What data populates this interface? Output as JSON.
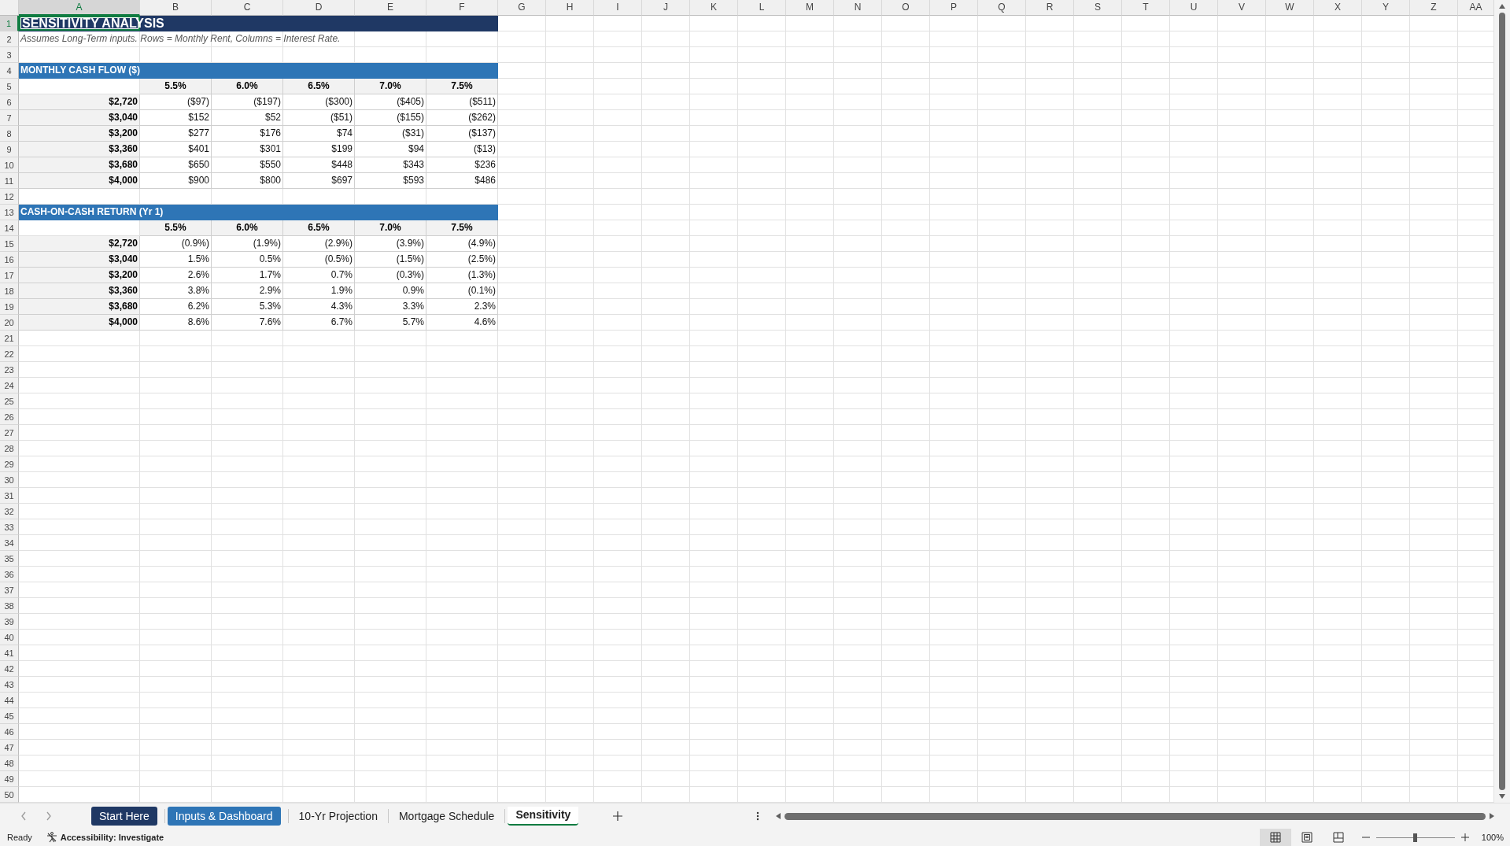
{
  "column_headers": [
    {
      "label": "A",
      "selected": true
    },
    {
      "label": "B",
      "selected": false
    },
    {
      "label": "C",
      "selected": false
    },
    {
      "label": "D",
      "selected": false
    },
    {
      "label": "E",
      "selected": false
    },
    {
      "label": "F",
      "selected": false
    },
    {
      "label": "G",
      "selected": false
    },
    {
      "label": "H",
      "selected": false
    },
    {
      "label": "I",
      "selected": false
    },
    {
      "label": "J",
      "selected": false
    },
    {
      "label": "K",
      "selected": false
    },
    {
      "label": "L",
      "selected": false
    },
    {
      "label": "M",
      "selected": false
    },
    {
      "label": "N",
      "selected": false
    },
    {
      "label": "O",
      "selected": false
    },
    {
      "label": "P",
      "selected": false
    },
    {
      "label": "Q",
      "selected": false
    },
    {
      "label": "R",
      "selected": false
    },
    {
      "label": "S",
      "selected": false
    },
    {
      "label": "T",
      "selected": false
    },
    {
      "label": "U",
      "selected": false
    },
    {
      "label": "V",
      "selected": false
    },
    {
      "label": "W",
      "selected": false
    },
    {
      "label": "X",
      "selected": false
    },
    {
      "label": "Y",
      "selected": false
    },
    {
      "label": "Z",
      "selected": false
    },
    {
      "label": "AA",
      "selected": false
    }
  ],
  "row_headers": [
    {
      "label": "1",
      "selected": true
    },
    {
      "label": "2",
      "selected": false
    },
    {
      "label": "3",
      "selected": false
    },
    {
      "label": "4",
      "selected": false
    },
    {
      "label": "5",
      "selected": false
    },
    {
      "label": "6",
      "selected": false
    },
    {
      "label": "7",
      "selected": false
    },
    {
      "label": "8",
      "selected": false
    },
    {
      "label": "9",
      "selected": false
    },
    {
      "label": "10",
      "selected": false
    },
    {
      "label": "11",
      "selected": false
    },
    {
      "label": "12",
      "selected": false
    },
    {
      "label": "13",
      "selected": false
    },
    {
      "label": "14",
      "selected": false
    },
    {
      "label": "15",
      "selected": false
    },
    {
      "label": "16",
      "selected": false
    },
    {
      "label": "17",
      "selected": false
    },
    {
      "label": "18",
      "selected": false
    },
    {
      "label": "19",
      "selected": false
    },
    {
      "label": "20",
      "selected": false
    },
    {
      "label": "21",
      "selected": false
    },
    {
      "label": "22",
      "selected": false
    },
    {
      "label": "23",
      "selected": false
    },
    {
      "label": "24",
      "selected": false
    },
    {
      "label": "25",
      "selected": false
    },
    {
      "label": "26",
      "selected": false
    },
    {
      "label": "27",
      "selected": false
    },
    {
      "label": "28",
      "selected": false
    },
    {
      "label": "29",
      "selected": false
    },
    {
      "label": "30",
      "selected": false
    },
    {
      "label": "31",
      "selected": false
    },
    {
      "label": "32",
      "selected": false
    },
    {
      "label": "33",
      "selected": false
    },
    {
      "label": "34",
      "selected": false
    },
    {
      "label": "35",
      "selected": false
    },
    {
      "label": "36",
      "selected": false
    },
    {
      "label": "37",
      "selected": false
    },
    {
      "label": "38",
      "selected": false
    },
    {
      "label": "39",
      "selected": false
    },
    {
      "label": "40",
      "selected": false
    },
    {
      "label": "41",
      "selected": false
    },
    {
      "label": "42",
      "selected": false
    },
    {
      "label": "43",
      "selected": false
    },
    {
      "label": "44",
      "selected": false
    },
    {
      "label": "45",
      "selected": false
    },
    {
      "label": "46",
      "selected": false
    },
    {
      "label": "47",
      "selected": false
    },
    {
      "label": "48",
      "selected": false
    },
    {
      "label": "49",
      "selected": false
    },
    {
      "label": "50",
      "selected": false
    }
  ],
  "title": "SENSITIVITY ANALYSIS",
  "note": "Assumes Long-Term inputs. Rows = Monthly Rent, Columns = Interest Rate.",
  "sections": [
    {
      "heading": "MONTHLY CASH FLOW ($)",
      "rates": [
        "5.5%",
        "6.0%",
        "6.5%",
        "7.0%",
        "7.5%"
      ],
      "rows": [
        {
          "rent": "$2,720",
          "values": [
            "($97)",
            "($197)",
            "($300)",
            "($405)",
            "($511)"
          ]
        },
        {
          "rent": "$3,040",
          "values": [
            "$152",
            "$52",
            "($51)",
            "($155)",
            "($262)"
          ]
        },
        {
          "rent": "$3,200",
          "values": [
            "$277",
            "$176",
            "$74",
            "($31)",
            "($137)"
          ]
        },
        {
          "rent": "$3,360",
          "values": [
            "$401",
            "$301",
            "$199",
            "$94",
            "($13)"
          ]
        },
        {
          "rent": "$3,680",
          "values": [
            "$650",
            "$550",
            "$448",
            "$343",
            "$236"
          ]
        },
        {
          "rent": "$4,000",
          "values": [
            "$900",
            "$800",
            "$697",
            "$593",
            "$486"
          ]
        }
      ]
    },
    {
      "heading": "CASH-ON-CASH RETURN (Yr 1)",
      "rates": [
        "5.5%",
        "6.0%",
        "6.5%",
        "7.0%",
        "7.5%"
      ],
      "rows": [
        {
          "rent": "$2,720",
          "values": [
            "(0.9%)",
            "(1.9%)",
            "(2.9%)",
            "(3.9%)",
            "(4.9%)"
          ]
        },
        {
          "rent": "$3,040",
          "values": [
            "1.5%",
            "0.5%",
            "(0.5%)",
            "(1.5%)",
            "(2.5%)"
          ]
        },
        {
          "rent": "$3,200",
          "values": [
            "2.6%",
            "1.7%",
            "0.7%",
            "(0.3%)",
            "(1.3%)"
          ]
        },
        {
          "rent": "$3,360",
          "values": [
            "3.8%",
            "2.9%",
            "1.9%",
            "0.9%",
            "(0.1%)"
          ]
        },
        {
          "rent": "$3,680",
          "values": [
            "6.2%",
            "5.3%",
            "4.3%",
            "3.3%",
            "2.3%"
          ]
        },
        {
          "rent": "$4,000",
          "values": [
            "8.6%",
            "7.6%",
            "6.7%",
            "5.7%",
            "4.6%"
          ]
        }
      ]
    }
  ],
  "sheet_tabs": [
    {
      "label": "Start Here",
      "selected": false,
      "color": "#1f3864"
    },
    {
      "label": "Inputs & Dashboard",
      "selected": false,
      "color": "#2e75b6"
    },
    {
      "label": "10-Yr Projection",
      "selected": false
    },
    {
      "label": "Mortgage Schedule",
      "selected": false
    },
    {
      "label": "Sensitivity",
      "selected": true
    }
  ],
  "status_bar": {
    "mode": "Ready",
    "accessibility": "Accessibility: Investigate",
    "views": [
      {
        "kind": "normal",
        "selected": true
      },
      {
        "kind": "page_layout",
        "selected": false
      },
      {
        "kind": "page_break",
        "selected": false
      }
    ],
    "zoom": {
      "level": 0.5,
      "label": "100%"
    }
  }
}
